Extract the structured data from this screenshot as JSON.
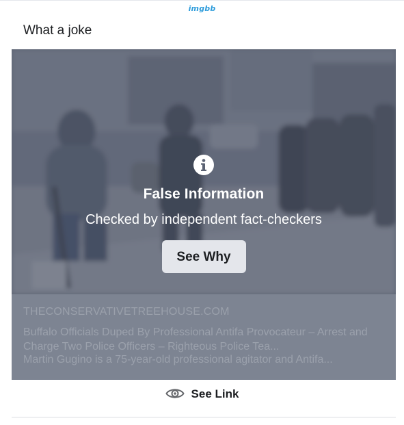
{
  "watermark": "imgbb",
  "post": {
    "text": "What a joke"
  },
  "warning": {
    "icon": "info-icon",
    "title": "False Information",
    "subtitle": "Checked by independent fact-checkers",
    "button_label": "See Why"
  },
  "link_preview": {
    "domain": "THECONSERVATIVETREEHOUSE.COM",
    "title": "Buffalo Officials Duped By Professional Antifa Provocateur – Arrest and Charge Two Police Officers – Righteous Police Tea...",
    "description": "Martin Gugino is a 75-year-old professional agitator and Antifa..."
  },
  "see_link": {
    "icon": "eye-icon",
    "label": "See Link"
  },
  "colors": {
    "overlay": "#4e5668",
    "button_bg": "#e4e6eb",
    "text_primary": "#1c1e21",
    "watermark": "#2d9cdb"
  }
}
